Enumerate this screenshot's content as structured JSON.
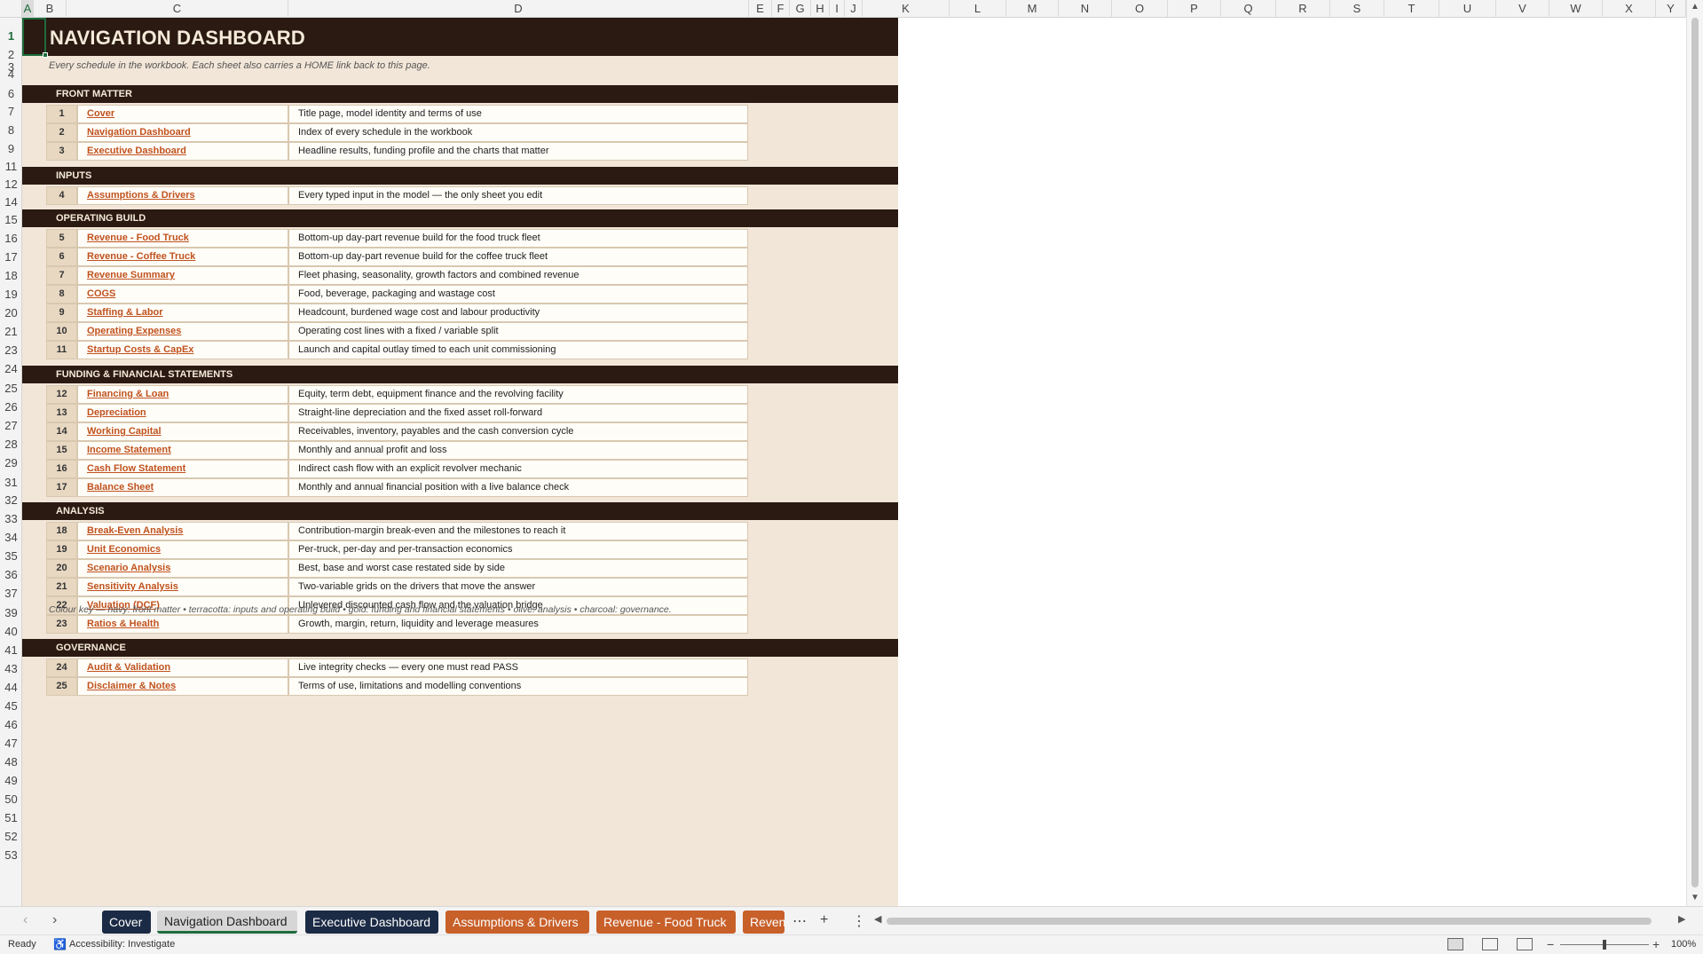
{
  "columns": [
    "A",
    "B",
    "C",
    "D",
    "E",
    "F",
    "G",
    "H",
    "I",
    "J",
    "K",
    "L",
    "M",
    "N",
    "O",
    "P",
    "Q",
    "R",
    "S",
    "T",
    "U",
    "V",
    "W",
    "X",
    "Y"
  ],
  "rows": [
    "1",
    "2",
    "3",
    "4",
    "6",
    "7",
    "8",
    "9",
    "11",
    "12",
    "14",
    "15",
    "16",
    "17",
    "18",
    "19",
    "20",
    "21",
    "23",
    "24",
    "25",
    "26",
    "27",
    "28",
    "29",
    "31",
    "32",
    "33",
    "34",
    "35",
    "36",
    "37",
    "39",
    "40",
    "41",
    "43",
    "44",
    "45",
    "46",
    "47",
    "48",
    "49",
    "50",
    "51",
    "52",
    "53"
  ],
  "sheet": {
    "title": "NAVIGATION DASHBOARD",
    "subtitle": "Every schedule in the workbook. Each sheet also carries a HOME link back to this page.",
    "sections": [
      {
        "label": "FRONT MATTER",
        "items": [
          {
            "num": "1",
            "name": "Cover",
            "desc": "Title page, model identity and terms of use"
          },
          {
            "num": "2",
            "name": "Navigation Dashboard",
            "desc": "Index of every schedule in the workbook"
          },
          {
            "num": "3",
            "name": "Executive Dashboard",
            "desc": "Headline results, funding profile and the charts that matter"
          }
        ]
      },
      {
        "label": "INPUTS",
        "items": [
          {
            "num": "4",
            "name": "Assumptions & Drivers",
            "desc": "Every typed input in the model — the only sheet you edit"
          }
        ]
      },
      {
        "label": "OPERATING BUILD",
        "items": [
          {
            "num": "5",
            "name": "Revenue - Food Truck",
            "desc": "Bottom-up day-part revenue build for the food truck fleet"
          },
          {
            "num": "6",
            "name": "Revenue - Coffee Truck",
            "desc": "Bottom-up day-part revenue build for the coffee truck fleet"
          },
          {
            "num": "7",
            "name": "Revenue Summary",
            "desc": "Fleet phasing, seasonality, growth factors and combined revenue"
          },
          {
            "num": "8",
            "name": "COGS",
            "desc": "Food, beverage, packaging and wastage cost"
          },
          {
            "num": "9",
            "name": "Staffing & Labor",
            "desc": "Headcount, burdened wage cost and labour productivity"
          },
          {
            "num": "10",
            "name": "Operating Expenses",
            "desc": "Operating cost lines with a fixed / variable split"
          },
          {
            "num": "11",
            "name": "Startup Costs & CapEx",
            "desc": "Launch and capital outlay timed to each unit commissioning"
          }
        ]
      },
      {
        "label": "FUNDING & FINANCIAL STATEMENTS",
        "items": [
          {
            "num": "12",
            "name": "Financing & Loan",
            "desc": "Equity, term debt, equipment finance and the revolving facility"
          },
          {
            "num": "13",
            "name": "Depreciation",
            "desc": "Straight-line depreciation and the fixed asset roll-forward"
          },
          {
            "num": "14",
            "name": "Working Capital",
            "desc": "Receivables, inventory, payables and the cash conversion cycle"
          },
          {
            "num": "15",
            "name": "Income Statement",
            "desc": "Monthly and annual profit and loss"
          },
          {
            "num": "16",
            "name": "Cash Flow Statement",
            "desc": "Indirect cash flow with an explicit revolver mechanic"
          },
          {
            "num": "17",
            "name": "Balance Sheet",
            "desc": "Monthly and annual financial position with a live balance check"
          }
        ]
      },
      {
        "label": "ANALYSIS",
        "items": [
          {
            "num": "18",
            "name": "Break-Even Analysis",
            "desc": "Contribution-margin break-even and the milestones to reach it"
          },
          {
            "num": "19",
            "name": "Unit Economics",
            "desc": "Per-truck, per-day and per-transaction economics"
          },
          {
            "num": "20",
            "name": "Scenario Analysis",
            "desc": "Best, base and worst case restated side by side"
          },
          {
            "num": "21",
            "name": "Sensitivity Analysis",
            "desc": "Two-variable grids on the drivers that move the answer"
          },
          {
            "num": "22",
            "name": "Valuation (DCF)",
            "desc": "Unlevered discounted cash flow and the valuation bridge"
          },
          {
            "num": "23",
            "name": "Ratios & Health",
            "desc": "Growth, margin, return, liquidity and leverage measures"
          }
        ]
      },
      {
        "label": "GOVERNANCE",
        "items": [
          {
            "num": "24",
            "name": "Audit & Validation",
            "desc": "Live integrity checks — every one must read PASS"
          },
          {
            "num": "25",
            "name": "Disclaimer & Notes",
            "desc": "Terms of use, limitations and modelling conventions"
          }
        ]
      }
    ],
    "colour_key": "Colour key —  navy: front matter   •   terracotta: inputs and operating build   •   gold: funding and financial statements   •   olive: analysis   •   charcoal: governance."
  },
  "tabs": [
    {
      "label": "Cover",
      "color": "#1c2b45",
      "active": false
    },
    {
      "label": "Navigation Dashboard",
      "color": "#d6d6d6",
      "active": true
    },
    {
      "label": "Executive Dashboard",
      "color": "#1c2b45",
      "active": false
    },
    {
      "label": "Assumptions & Drivers",
      "color": "#c8602a",
      "active": false
    },
    {
      "label": "Revenue - Food Truck",
      "color": "#c8602a",
      "active": false
    },
    {
      "label": "Reven",
      "color": "#c8602a",
      "active": false
    }
  ],
  "tabbar": {
    "more_label": "⋯",
    "add_label": "+",
    "options_label": "⋮"
  },
  "status": {
    "ready": "Ready",
    "accessibility": "Accessibility: Investigate",
    "zoom": "100%"
  },
  "colors": {
    "band": "#2a1a12",
    "canvas": "#f2e6d8",
    "link": "#c0521e",
    "selection": "#1f6b3c"
  }
}
